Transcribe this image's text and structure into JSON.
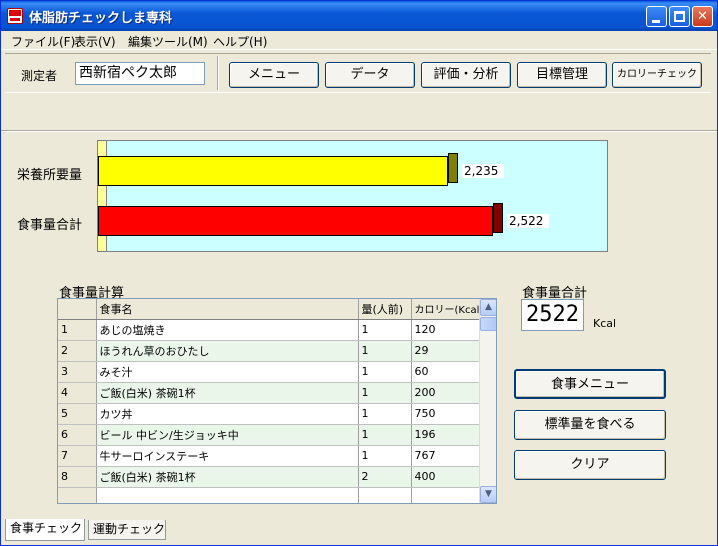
{
  "window": {
    "title": "体脂肪チェックしま専科"
  },
  "menu": [
    "ファイル(F)",
    "表示(V)",
    "編集ツール(M)",
    "ヘルプ(H)"
  ],
  "toolbar": {
    "measurer_label": "測定者",
    "measurer_name": "西新宿ペク太郎",
    "buttons": [
      "メニュー",
      "データ",
      "評価・分析",
      "目標管理",
      "カロリーチェック"
    ]
  },
  "chart_data": {
    "type": "bar",
    "orientation": "horizontal",
    "categories": [
      "栄養所要量",
      "食事量合計"
    ],
    "values": [
      2235,
      2522
    ],
    "value_labels": [
      "2,235",
      "2,522"
    ],
    "colors": [
      "#ffff00",
      "#ff0000"
    ],
    "xlim": [
      0,
      3000
    ]
  },
  "meal_table": {
    "title": "食事量計算",
    "columns": [
      "食事名",
      "量(人前)",
      "カロリー(Kcal)"
    ],
    "rows": [
      {
        "idx": "1",
        "name": "あじの塩焼き",
        "qty": "1",
        "kcal": "120"
      },
      {
        "idx": "2",
        "name": "ほうれん草のおひたし",
        "qty": "1",
        "kcal": "29"
      },
      {
        "idx": "3",
        "name": "みそ汁",
        "qty": "1",
        "kcal": "60"
      },
      {
        "idx": "4",
        "name": "ご飯(白米) 茶碗1杯",
        "qty": "1",
        "kcal": "200"
      },
      {
        "idx": "5",
        "name": "カツ丼",
        "qty": "1",
        "kcal": "750"
      },
      {
        "idx": "6",
        "name": "ビール 中ビン/生ジョッキ中",
        "qty": "1",
        "kcal": "196"
      },
      {
        "idx": "7",
        "name": "牛サーロインステーキ",
        "qty": "1",
        "kcal": "767"
      },
      {
        "idx": "8",
        "name": "ご飯(白米) 茶碗1杯",
        "qty": "2",
        "kcal": "400"
      },
      {
        "idx": "",
        "name": "",
        "qty": "",
        "kcal": ""
      }
    ]
  },
  "total": {
    "label": "食事量合計",
    "value": "2522",
    "unit": "Kcal"
  },
  "side_buttons": [
    "食事メニュー",
    "標準量を食べる",
    "クリア"
  ],
  "tabs": [
    "食事チェック",
    "運動チェック"
  ]
}
